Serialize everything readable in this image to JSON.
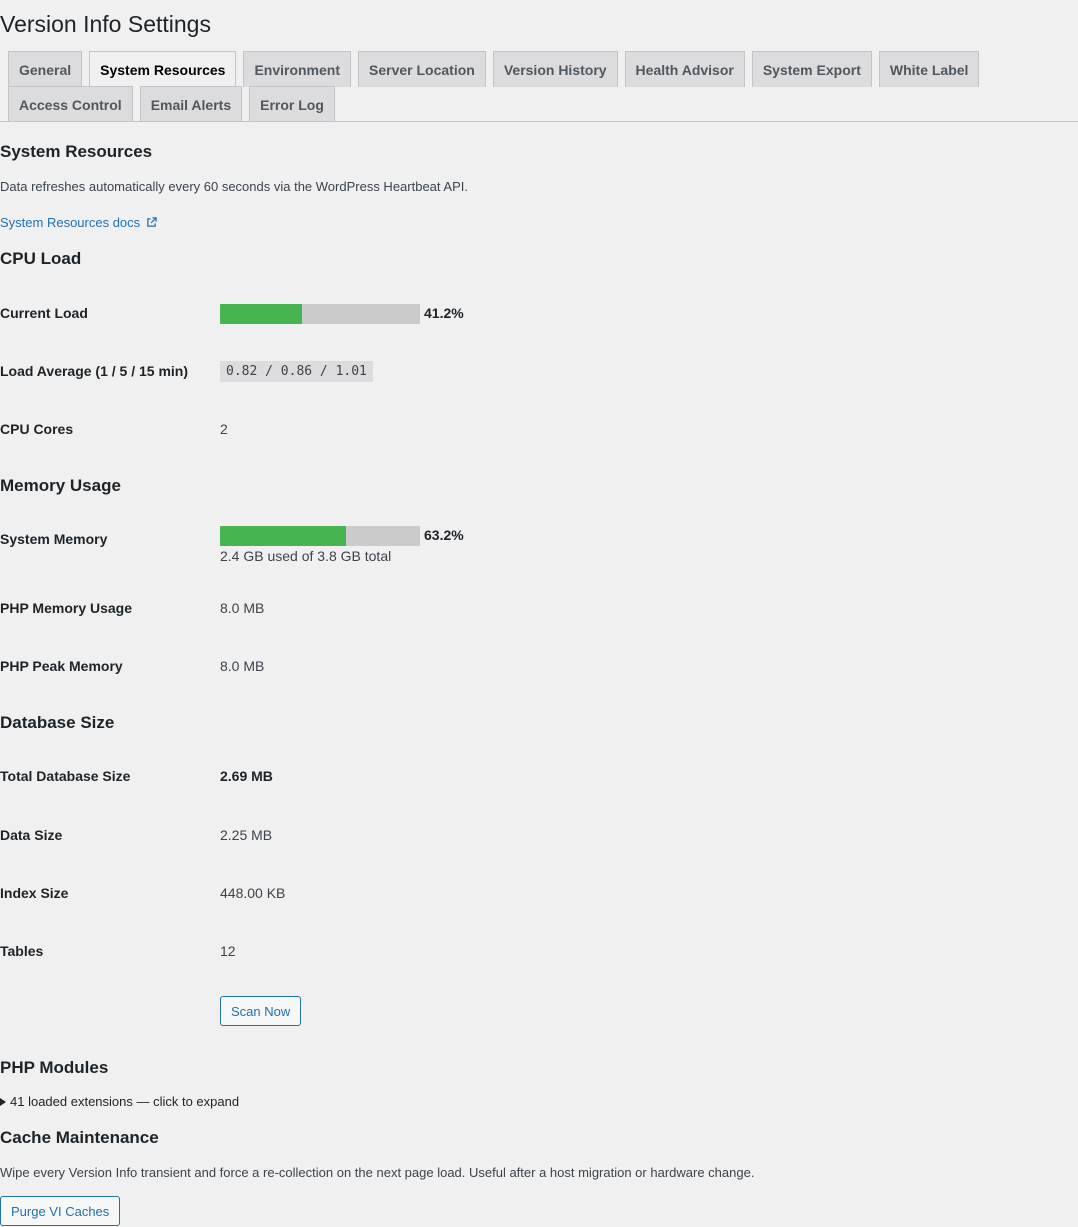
{
  "page": {
    "title": "Version Info Settings"
  },
  "tabs": {
    "row1": [
      "General",
      "System Resources",
      "Environment",
      "Server Location",
      "Version History",
      "Health Advisor",
      "System Export",
      "White Label"
    ],
    "row2": [
      "Access Control",
      "Email Alerts",
      "Error Log"
    ],
    "active": "System Resources"
  },
  "intro": {
    "heading": "System Resources",
    "description": "Data refreshes automatically every 60 seconds via the WordPress Heartbeat API.",
    "docs_link": "System Resources docs"
  },
  "cpu": {
    "heading": "CPU Load",
    "current_load_label": "Current Load",
    "current_load_pct": 41.2,
    "current_load_text": "41.2%",
    "load_avg_label": "Load Average (1 / 5 / 15 min)",
    "load_avg_value": "0.82 / 0.86 / 1.01",
    "cores_label": "CPU Cores",
    "cores_value": "2"
  },
  "memory": {
    "heading": "Memory Usage",
    "system_label": "System Memory",
    "system_pct": 63.2,
    "system_pct_text": "63.2%",
    "system_detail": "2.4 GB used of 3.8 GB total",
    "php_usage_label": "PHP Memory Usage",
    "php_usage_value": "8.0 MB",
    "php_peak_label": "PHP Peak Memory",
    "php_peak_value": "8.0 MB"
  },
  "database": {
    "heading": "Database Size",
    "total_label": "Total Database Size",
    "total_value": "2.69 MB",
    "data_label": "Data Size",
    "data_value": "2.25 MB",
    "index_label": "Index Size",
    "index_value": "448.00 KB",
    "tables_label": "Tables",
    "tables_value": "12",
    "scan_button": "Scan Now"
  },
  "modules": {
    "heading": "PHP Modules",
    "summary": "41 loaded extensions — click to expand"
  },
  "cache": {
    "heading": "Cache Maintenance",
    "description": "Wipe every Version Info transient and force a re-collection on the next page load. Useful after a host migration or hardware change.",
    "purge_button": "Purge VI Caches"
  },
  "colors": {
    "bar_fill": "#46b450",
    "bar_track": "#cbcbcb",
    "link": "#2271b1"
  }
}
